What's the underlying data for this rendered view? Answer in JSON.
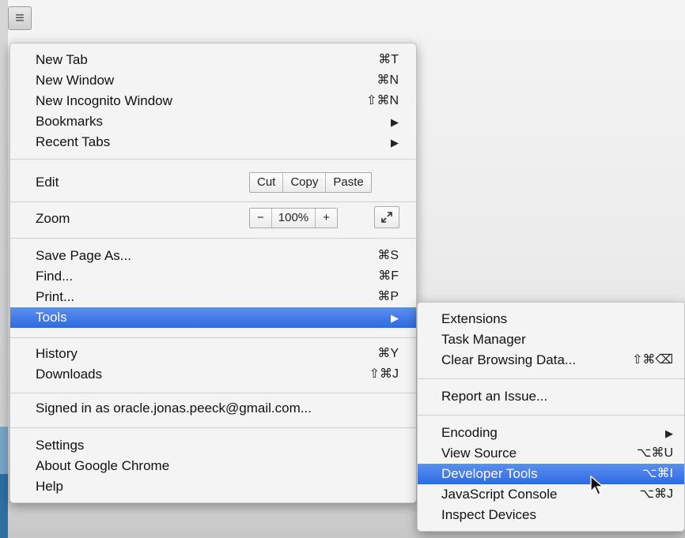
{
  "toolbar": {
    "menu_icon": "≡"
  },
  "menu": {
    "new_tab": {
      "label": "New Tab",
      "shortcut": "⌘T"
    },
    "new_window": {
      "label": "New Window",
      "shortcut": "⌘N"
    },
    "incognito": {
      "label": "New Incognito Window",
      "shortcut": "⇧⌘N"
    },
    "bookmarks": {
      "label": "Bookmarks",
      "arrow": "▶"
    },
    "recent_tabs": {
      "label": "Recent Tabs",
      "arrow": "▶"
    },
    "edit": {
      "label": "Edit",
      "cut": "Cut",
      "copy": "Copy",
      "paste": "Paste"
    },
    "zoom": {
      "label": "Zoom",
      "minus": "−",
      "value": "100%",
      "plus": "+"
    },
    "save_page": {
      "label": "Save Page As...",
      "shortcut": "⌘S"
    },
    "find": {
      "label": "Find...",
      "shortcut": "⌘F"
    },
    "print": {
      "label": "Print...",
      "shortcut": "⌘P"
    },
    "tools": {
      "label": "Tools",
      "arrow": "▶"
    },
    "history": {
      "label": "History",
      "shortcut": "⌘Y"
    },
    "downloads": {
      "label": "Downloads",
      "shortcut": "⇧⌘J"
    },
    "signed_in": {
      "label": "Signed in as oracle.jonas.peeck@gmail.com..."
    },
    "settings": {
      "label": "Settings"
    },
    "about": {
      "label": "About Google Chrome"
    },
    "help": {
      "label": "Help"
    }
  },
  "tools_submenu": {
    "extensions": {
      "label": "Extensions"
    },
    "task_manager": {
      "label": "Task Manager"
    },
    "clear_data": {
      "label": "Clear Browsing Data...",
      "shortcut": "⇧⌘⌫"
    },
    "report_issue": {
      "label": "Report an Issue..."
    },
    "encoding": {
      "label": "Encoding",
      "arrow": "▶"
    },
    "view_source": {
      "label": "View Source",
      "shortcut": "⌥⌘U"
    },
    "dev_tools": {
      "label": "Developer Tools",
      "shortcut": "⌥⌘I"
    },
    "js_console": {
      "label": "JavaScript Console",
      "shortcut": "⌥⌘J"
    },
    "inspect_devices": {
      "label": "Inspect Devices"
    }
  },
  "colors": {
    "highlight": "#3b74e8",
    "menu_bg": "#f4f4f4"
  }
}
